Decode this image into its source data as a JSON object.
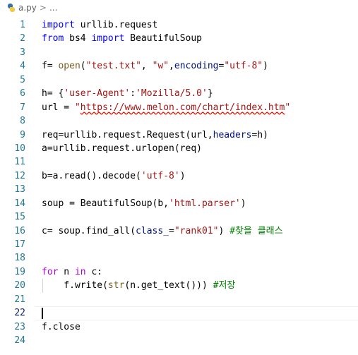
{
  "breadcrumb": {
    "file": "a.py",
    "separator": ">",
    "more": "..."
  },
  "editor": {
    "language": "python",
    "active_line": 22,
    "lines": [
      {
        "num": "1",
        "code": "import urllib.request"
      },
      {
        "num": "2",
        "code": "from bs4 import BeautifulSoup"
      },
      {
        "num": "3",
        "code": ""
      },
      {
        "num": "4",
        "code": "f= open(\"test.txt\", \"w\",encoding=\"utf-8\")"
      },
      {
        "num": "5",
        "code": ""
      },
      {
        "num": "6",
        "code": "h= {'user-Agent':'Mozilla/5.0'}"
      },
      {
        "num": "7",
        "code": "url = \"https://www.melon.com/chart/index.htm\""
      },
      {
        "num": "8",
        "code": ""
      },
      {
        "num": "9",
        "code": "req=urllib.request.Request(url,headers=h)"
      },
      {
        "num": "10",
        "code": "a=urllib.request.urlopen(req)"
      },
      {
        "num": "11",
        "code": ""
      },
      {
        "num": "12",
        "code": "b=a.read().decode('utf-8')"
      },
      {
        "num": "13",
        "code": ""
      },
      {
        "num": "14",
        "code": "soup = BeautifulSoup(b,'html.parser')"
      },
      {
        "num": "15",
        "code": ""
      },
      {
        "num": "16",
        "code": "c= soup.find_all(class_=\"rank01\") #찾을 클래스"
      },
      {
        "num": "17",
        "code": ""
      },
      {
        "num": "18",
        "code": ""
      },
      {
        "num": "19",
        "code": "for n in c:"
      },
      {
        "num": "20",
        "code": "    f.write(str(n.get_text())) #저장"
      },
      {
        "num": "21",
        "code": ""
      },
      {
        "num": "22",
        "code": ""
      },
      {
        "num": "23",
        "code": "f.close"
      },
      {
        "num": "24",
        "code": ""
      }
    ]
  },
  "colors": {
    "keyword": "#0000ff",
    "control_keyword": "#af00db",
    "string": "#a31515",
    "comment": "#008000",
    "function": "#795e26",
    "parameter": "#001080",
    "builtin": "#267f99",
    "line_number": "#237893",
    "error_squiggle": "#e51400"
  }
}
